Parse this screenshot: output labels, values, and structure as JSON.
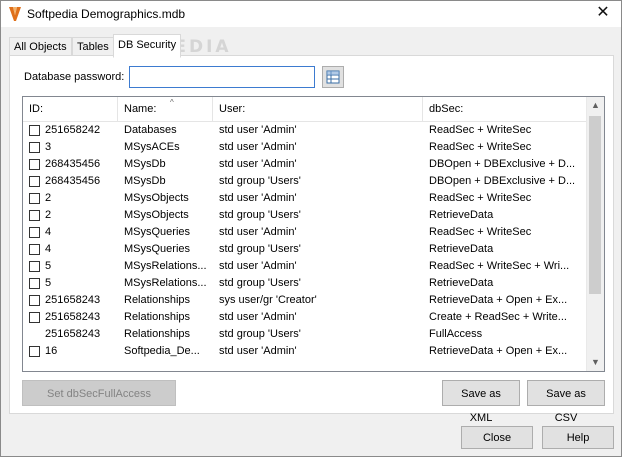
{
  "window": {
    "title": "Softpedia Demographics.mdb",
    "watermark": "SOFTPEDIA"
  },
  "tabs": [
    {
      "label": "All Objects",
      "active": false
    },
    {
      "label": "Tables",
      "active": false
    },
    {
      "label": "DB Security",
      "active": true
    }
  ],
  "password": {
    "label": "Database password:",
    "value": ""
  },
  "grid": {
    "columns": [
      "ID:",
      "Name:",
      "User:",
      "dbSec:"
    ],
    "rows": [
      {
        "checkbox": true,
        "id": "251658242",
        "name": "Databases",
        "user": "std user 'Admin'",
        "dbsec": "ReadSec + WriteSec"
      },
      {
        "checkbox": true,
        "id": "3",
        "name": "MSysACEs",
        "user": "std user 'Admin'",
        "dbsec": "ReadSec + WriteSec"
      },
      {
        "checkbox": true,
        "id": "268435456",
        "name": "MSysDb",
        "user": "std user 'Admin'",
        "dbsec": "DBOpen + DBExclusive + D..."
      },
      {
        "checkbox": true,
        "id": "268435456",
        "name": "MSysDb",
        "user": "std group 'Users'",
        "dbsec": "DBOpen + DBExclusive + D..."
      },
      {
        "checkbox": true,
        "id": "2",
        "name": "MSysObjects",
        "user": "std user 'Admin'",
        "dbsec": "ReadSec + WriteSec"
      },
      {
        "checkbox": true,
        "id": "2",
        "name": "MSysObjects",
        "user": "std group 'Users'",
        "dbsec": "RetrieveData"
      },
      {
        "checkbox": true,
        "id": "4",
        "name": "MSysQueries",
        "user": "std user 'Admin'",
        "dbsec": "ReadSec + WriteSec"
      },
      {
        "checkbox": true,
        "id": "4",
        "name": "MSysQueries",
        "user": "std group 'Users'",
        "dbsec": "RetrieveData"
      },
      {
        "checkbox": true,
        "id": "5",
        "name": "MSysRelations...",
        "user": "std user 'Admin'",
        "dbsec": "ReadSec + WriteSec + Wri..."
      },
      {
        "checkbox": true,
        "id": "5",
        "name": "MSysRelations...",
        "user": "std group 'Users'",
        "dbsec": "RetrieveData"
      },
      {
        "checkbox": true,
        "id": "251658243",
        "name": "Relationships",
        "user": "sys user/gr 'Creator'",
        "dbsec": "RetrieveData + Open + Ex..."
      },
      {
        "checkbox": true,
        "id": "251658243",
        "name": "Relationships",
        "user": "std user 'Admin'",
        "dbsec": "Create + ReadSec + Write..."
      },
      {
        "checkbox": false,
        "id": "251658243",
        "name": "Relationships",
        "user": "std group 'Users'",
        "dbsec": "FullAccess"
      },
      {
        "checkbox": true,
        "id": "16",
        "name": "Softpedia_De...",
        "user": "std user 'Admin'",
        "dbsec": "RetrieveData + Open + Ex..."
      }
    ]
  },
  "buttons": {
    "set_full_access": "Set dbSecFullAccess",
    "save_xml": "Save as XML",
    "save_csv": "Save as CSV",
    "close": "Close",
    "help": "Help"
  }
}
